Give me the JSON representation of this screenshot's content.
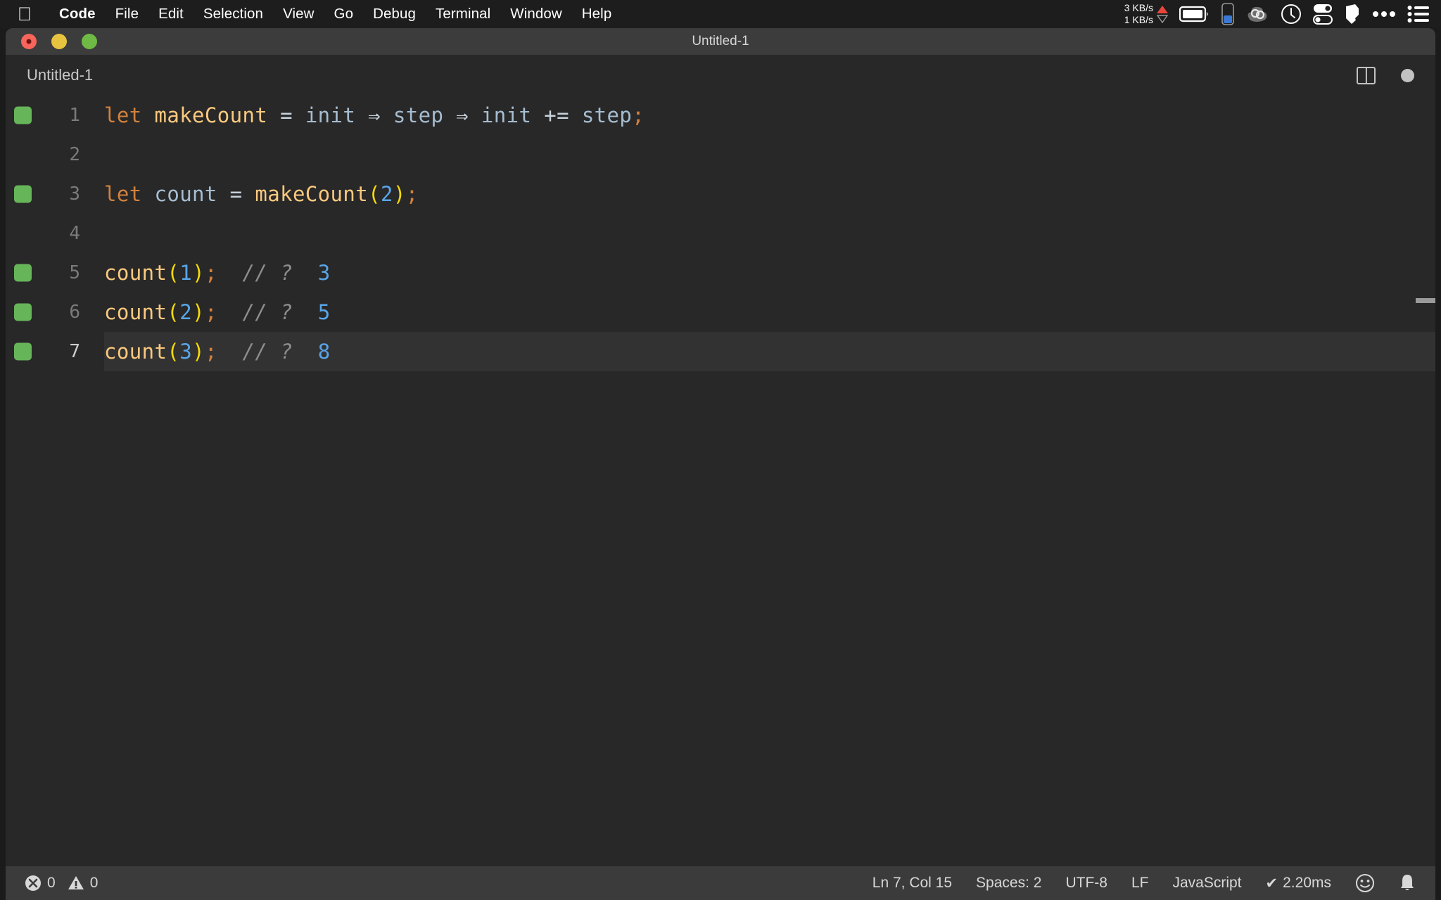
{
  "menubar": {
    "apple_icon": "apple-logo",
    "items": [
      {
        "label": "Code",
        "bold": true
      },
      {
        "label": "File"
      },
      {
        "label": "Edit"
      },
      {
        "label": "Selection"
      },
      {
        "label": "View"
      },
      {
        "label": "Go"
      },
      {
        "label": "Debug"
      },
      {
        "label": "Terminal"
      },
      {
        "label": "Window"
      },
      {
        "label": "Help"
      }
    ],
    "network": {
      "upload": "3 KB/s",
      "download": "1 KB/s",
      "up_arrow_color": "#e8453c",
      "down_arrow_color": "#9a9a9a"
    },
    "status_icons": [
      "battery-icon",
      "battery-vertical-icon",
      "cloud-sync-icon",
      "clock-icon",
      "toggles-icon",
      "shield-icon",
      "ellipsis-icon",
      "control-center-icon"
    ]
  },
  "window": {
    "title": "Untitled-1",
    "traffic_lights": [
      "close",
      "minimize",
      "maximize"
    ]
  },
  "tabbar": {
    "tabs": [
      {
        "label": "Untitled-1",
        "active": true,
        "dirty": true
      }
    ],
    "actions": [
      "split-editor-icon",
      "unsaved-dot-icon"
    ]
  },
  "editor": {
    "language": "JavaScript",
    "lines": [
      {
        "number": "1",
        "marker": true,
        "active": false,
        "tokens": [
          {
            "t": "let",
            "c": "tk-key"
          },
          {
            "t": " ",
            "c": "tk-op"
          },
          {
            "t": "makeCount",
            "c": "tk-fn"
          },
          {
            "t": " = ",
            "c": "tk-op"
          },
          {
            "t": "init",
            "c": "tk-var"
          },
          {
            "t": " ⇒ ",
            "c": "tk-op"
          },
          {
            "t": "step",
            "c": "tk-var"
          },
          {
            "t": " ⇒ ",
            "c": "tk-op"
          },
          {
            "t": "init",
            "c": "tk-var"
          },
          {
            "t": " += ",
            "c": "tk-op"
          },
          {
            "t": "step",
            "c": "tk-var"
          },
          {
            "t": ";",
            "c": "tk-punc"
          }
        ]
      },
      {
        "number": "2",
        "marker": false,
        "active": false,
        "tokens": []
      },
      {
        "number": "3",
        "marker": true,
        "active": false,
        "tokens": [
          {
            "t": "let",
            "c": "tk-key"
          },
          {
            "t": " ",
            "c": "tk-op"
          },
          {
            "t": "count",
            "c": "tk-var"
          },
          {
            "t": " = ",
            "c": "tk-op"
          },
          {
            "t": "makeCount",
            "c": "tk-fn"
          },
          {
            "t": "(",
            "c": "tk-paren"
          },
          {
            "t": "2",
            "c": "tk-num"
          },
          {
            "t": ")",
            "c": "tk-paren"
          },
          {
            "t": ";",
            "c": "tk-punc"
          }
        ]
      },
      {
        "number": "4",
        "marker": false,
        "active": false,
        "tokens": []
      },
      {
        "number": "5",
        "marker": true,
        "active": false,
        "tokens": [
          {
            "t": "count",
            "c": "tk-fn"
          },
          {
            "t": "(",
            "c": "tk-paren"
          },
          {
            "t": "1",
            "c": "tk-num"
          },
          {
            "t": ")",
            "c": "tk-paren"
          },
          {
            "t": ";",
            "c": "tk-punc"
          },
          {
            "t": "  // ?",
            "c": "tk-comment"
          },
          {
            "t": "  3",
            "c": "tk-result"
          }
        ]
      },
      {
        "number": "6",
        "marker": true,
        "active": false,
        "tokens": [
          {
            "t": "count",
            "c": "tk-fn"
          },
          {
            "t": "(",
            "c": "tk-paren"
          },
          {
            "t": "2",
            "c": "tk-num"
          },
          {
            "t": ")",
            "c": "tk-paren"
          },
          {
            "t": ";",
            "c": "tk-punc"
          },
          {
            "t": "  // ?",
            "c": "tk-comment"
          },
          {
            "t": "  5",
            "c": "tk-result"
          }
        ]
      },
      {
        "number": "7",
        "marker": true,
        "active": true,
        "tokens": [
          {
            "t": "count",
            "c": "tk-fn"
          },
          {
            "t": "(",
            "c": "tk-paren"
          },
          {
            "t": "3",
            "c": "tk-num"
          },
          {
            "t": ")",
            "c": "tk-paren"
          },
          {
            "t": ";",
            "c": "tk-punc"
          },
          {
            "t": "  // ?",
            "c": "tk-comment"
          },
          {
            "t": "  8",
            "c": "tk-result"
          }
        ]
      }
    ],
    "marker_color": "#67b559"
  },
  "statusbar": {
    "errors": "0",
    "warnings": "0",
    "cursor_position": "Ln 7, Col 15",
    "indentation": "Spaces: 2",
    "encoding": "UTF-8",
    "eol": "LF",
    "language": "JavaScript",
    "run_time": "2.20ms",
    "run_time_prefix": "✔",
    "feedback_icon": "smiley-icon",
    "notifications_icon": "bell-icon"
  }
}
